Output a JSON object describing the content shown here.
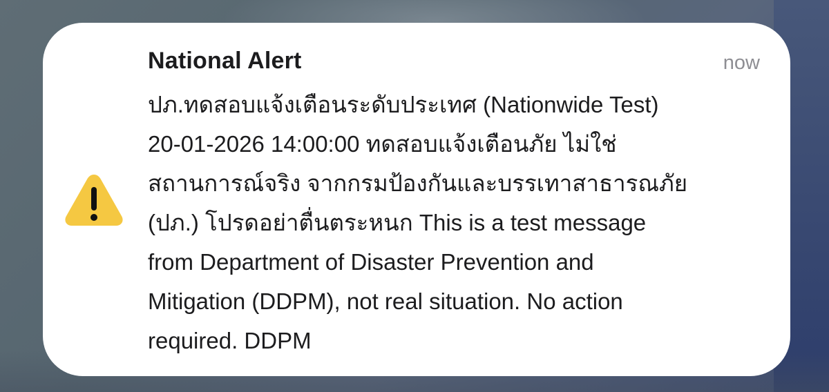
{
  "notification": {
    "app_title": "National Alert",
    "timestamp": "now",
    "icon": "warning-icon",
    "body_lines": [
      "ปภ.ทดสอบแจ้งเตือนระดับประเทศ (Nationwide Test)",
      "20-01-2026 14:00:00 ทดสอบแจ้งเตือนภัย ไม่ใช่",
      "สถานการณ์จริง จากกรมป้องกันและบรรเทาสาธารณภัย",
      "(ปภ.) โปรดอย่าตื่นตระหนก This is a test message",
      "from Department of Disaster Prevention and",
      "Mitigation (DDPM), not real situation. No action",
      "required. DDPM"
    ]
  },
  "colors": {
    "icon_fill": "#F5C842",
    "title_text": "#1C1C1E",
    "timestamp_text": "#8E8E93",
    "card_background": "#FFFFFF"
  }
}
